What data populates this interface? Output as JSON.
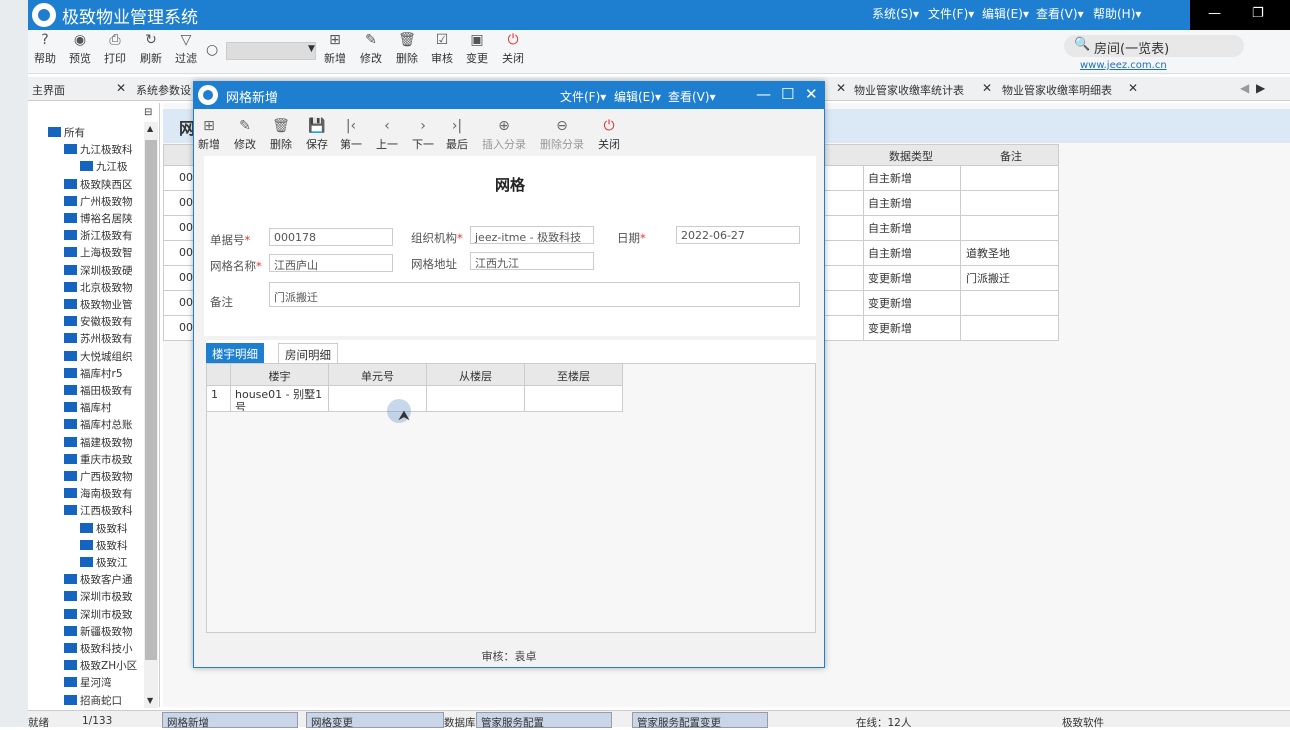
{
  "app": {
    "title": "极致物业管理系统",
    "menus": [
      "系统(S)▾",
      "文件(F)▾",
      "编辑(E)▾",
      "查看(V)▾",
      "帮助(H)▾"
    ]
  },
  "toolbar": [
    {
      "label": "帮助",
      "icon": "help-icon"
    },
    {
      "label": "预览",
      "icon": "eye-icon"
    },
    {
      "label": "打印",
      "icon": "printer-icon"
    },
    {
      "label": "刷新",
      "icon": "refresh-icon"
    },
    {
      "label": "过滤",
      "icon": "filter-icon"
    },
    {
      "label": "新增",
      "icon": "add-icon"
    },
    {
      "label": "修改",
      "icon": "edit-icon"
    },
    {
      "label": "删除",
      "icon": "trash-icon"
    },
    {
      "label": "审核",
      "icon": "check-icon"
    },
    {
      "label": "变更",
      "icon": "change-icon"
    },
    {
      "label": "关闭",
      "icon": "power-icon"
    }
  ],
  "search": {
    "placeholder": "房间(一览表)",
    "url": "www.jeez.com.cn"
  },
  "tabs": [
    "主界面",
    "系统参数设",
    "物业管家收缴率统计表",
    "物业管家收缴率明细表"
  ],
  "tree": [
    {
      "label": "所有",
      "level": 0
    },
    {
      "label": "九江极致科",
      "level": 1
    },
    {
      "label": "九江极",
      "level": 2
    },
    {
      "label": "极致陕西区",
      "level": 1
    },
    {
      "label": "广州极致物",
      "level": 1
    },
    {
      "label": "博裕名居陕",
      "level": 1
    },
    {
      "label": "浙江极致有",
      "level": 1
    },
    {
      "label": "上海极致智",
      "level": 1
    },
    {
      "label": "深圳极致硬",
      "level": 1
    },
    {
      "label": "北京极致物",
      "level": 1
    },
    {
      "label": "极致物业管",
      "level": 1
    },
    {
      "label": "安徽极致有",
      "level": 1
    },
    {
      "label": "苏州极致有",
      "level": 1
    },
    {
      "label": "大悦城组织",
      "level": 1
    },
    {
      "label": "福库村r5",
      "level": 1
    },
    {
      "label": "福田极致有",
      "level": 1
    },
    {
      "label": "福库村",
      "level": 1
    },
    {
      "label": "福库村总账",
      "level": 1
    },
    {
      "label": "福建极致物",
      "level": 1
    },
    {
      "label": "重庆市极致",
      "level": 1
    },
    {
      "label": "广西极致物",
      "level": 1
    },
    {
      "label": "海南极致有",
      "level": 1
    },
    {
      "label": "江西极致科",
      "level": 1
    },
    {
      "label": "极致科",
      "level": 2
    },
    {
      "label": "极致科",
      "level": 2
    },
    {
      "label": "极致江",
      "level": 2
    },
    {
      "label": "极致客户通",
      "level": 1
    },
    {
      "label": "深圳市极致",
      "level": 1
    },
    {
      "label": "深圳市极致",
      "level": 1
    },
    {
      "label": "新疆极致物",
      "level": 1
    },
    {
      "label": "极致科技小",
      "level": 1
    },
    {
      "label": "极致ZH小区",
      "level": 1
    },
    {
      "label": "星河湾",
      "level": 1
    },
    {
      "label": "招商蛇口",
      "level": 1
    }
  ],
  "bg_grid": {
    "headers": [
      "数据类型",
      "备注"
    ],
    "rows": [
      {
        "code": "00",
        "type": "自主新增",
        "note": ""
      },
      {
        "code": "00",
        "type": "自主新增",
        "note": ""
      },
      {
        "code": "00",
        "type": "自主新增",
        "note": ""
      },
      {
        "code": "00",
        "type": "自主新增",
        "note": "道教圣地"
      },
      {
        "code": "00",
        "type": "变更新增",
        "note": "门派搬迁"
      },
      {
        "code": "00",
        "type": "变更新增",
        "note": ""
      },
      {
        "code": "00",
        "type": "变更新增",
        "note": ""
      }
    ]
  },
  "dialog": {
    "title": "网格新增",
    "menus": [
      "文件(F)▾",
      "编辑(E)▾",
      "查看(V)▾"
    ],
    "toolbar": [
      {
        "label": "新增",
        "icon": "add-icon",
        "enabled": true
      },
      {
        "label": "修改",
        "icon": "edit-icon",
        "enabled": true
      },
      {
        "label": "删除",
        "icon": "trash-icon",
        "enabled": true
      },
      {
        "label": "保存",
        "icon": "save-icon",
        "enabled": true
      },
      {
        "label": "第一",
        "icon": "first-icon",
        "enabled": true
      },
      {
        "label": "上一",
        "icon": "prev-icon",
        "enabled": true
      },
      {
        "label": "下一",
        "icon": "next-icon",
        "enabled": true
      },
      {
        "label": "最后",
        "icon": "last-icon",
        "enabled": true
      },
      {
        "label": "插入分录",
        "icon": "plus-circle-icon",
        "enabled": false
      },
      {
        "label": "删除分录",
        "icon": "minus-circle-icon",
        "enabled": false
      },
      {
        "label": "关闭",
        "icon": "power-icon",
        "enabled": true
      }
    ],
    "form_title": "网格",
    "fields": {
      "doc_no_label": "单据号",
      "doc_no": "000178",
      "org_label": "组织机构",
      "org": "jeez-itme - 极致科技",
      "date_label": "日期",
      "date": "2022-06-27",
      "name_label": "网格名称",
      "name": "江西庐山",
      "address_label": "网格地址",
      "address": "江西九江",
      "remark_label": "备注",
      "remark": "门派搬迁"
    },
    "tabs": [
      "楼宇明细",
      "房间明细"
    ],
    "grid": {
      "headers": [
        "楼宇",
        "单元号",
        "从楼层",
        "至楼层"
      ],
      "rows": [
        {
          "no": "1",
          "building": "house01 - 别墅1号",
          "unit": "",
          "from": "",
          "to": ""
        }
      ]
    },
    "footer": "审核：袁卓"
  },
  "status": {
    "ready": "就绪",
    "page": "1/133",
    "tabs": [
      "网格新增",
      "网格变更",
      "数据库",
      "管家服务配置",
      "管家服务配置变更"
    ],
    "online": "在线：12人",
    "company": "极致软件"
  },
  "colors": {
    "accent": "#1e7fd1",
    "required": "#e33333"
  }
}
